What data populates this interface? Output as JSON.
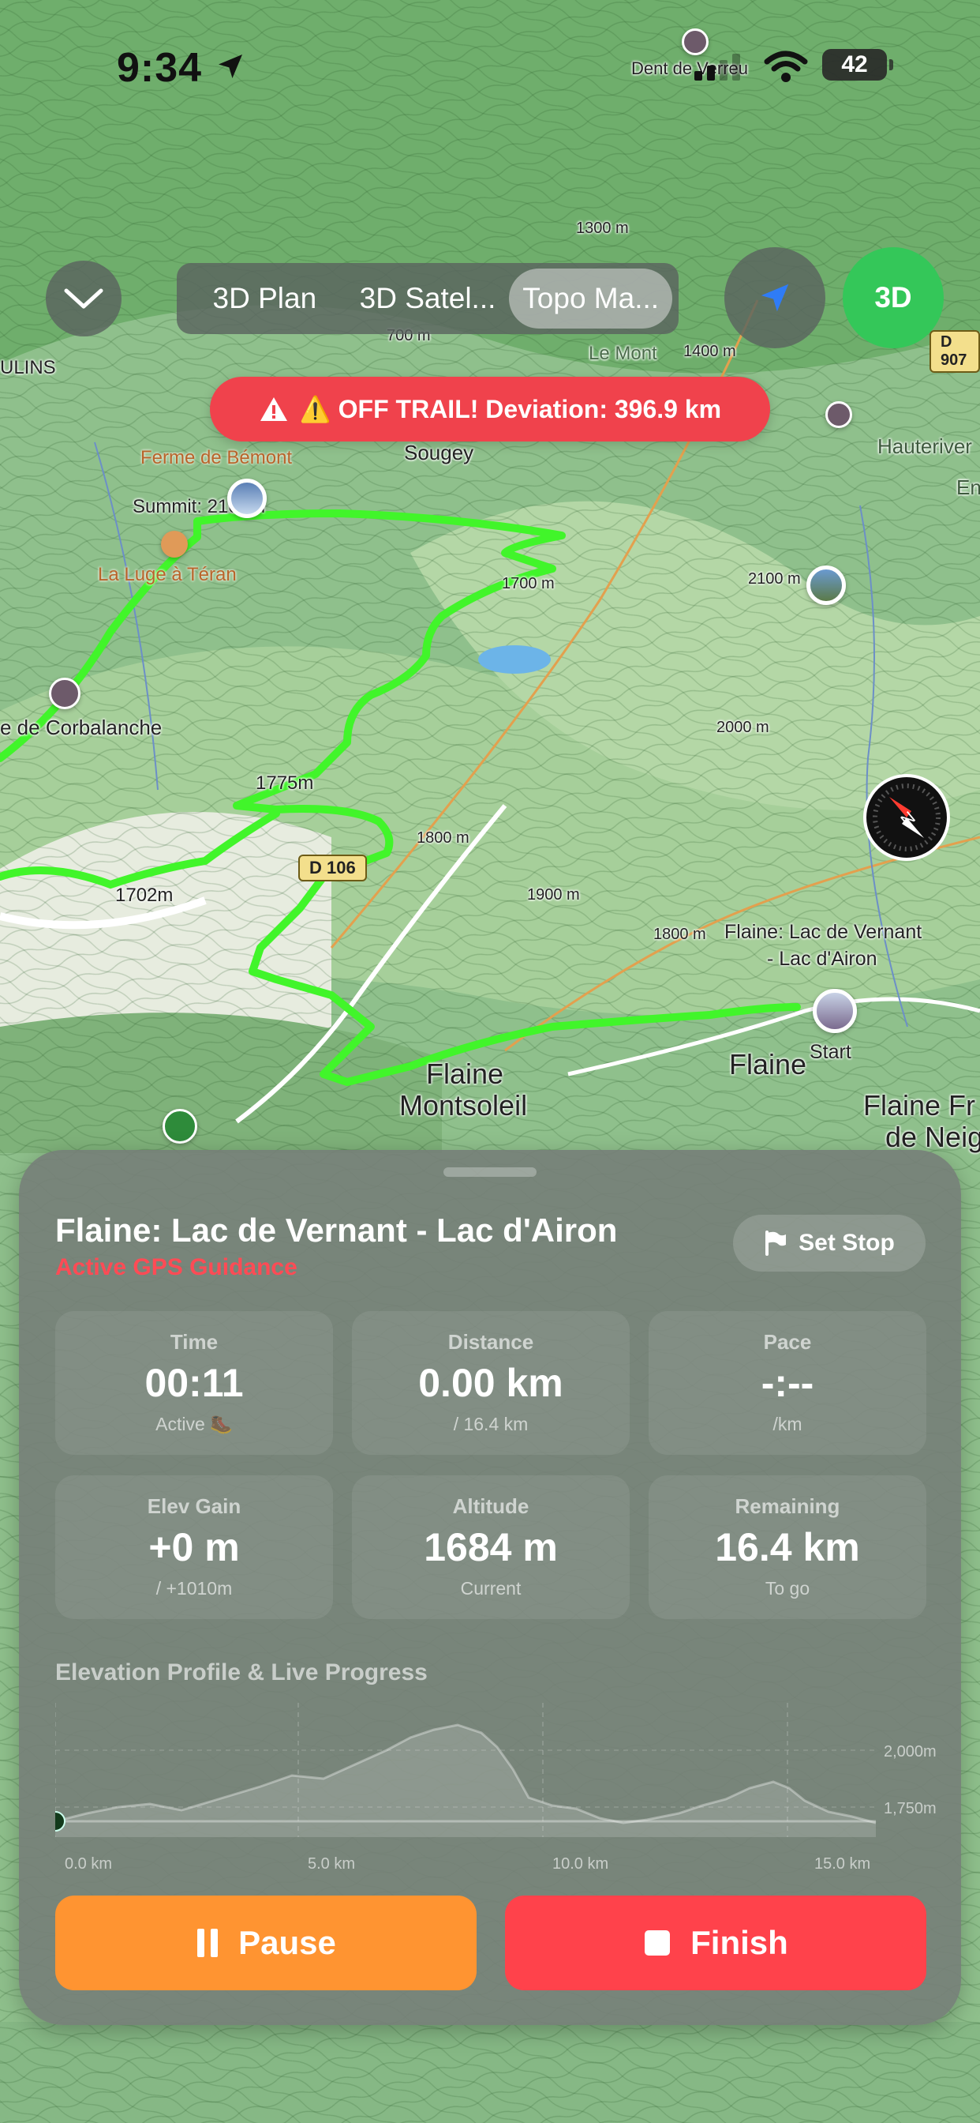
{
  "status_bar": {
    "time": "9:34",
    "battery": "42"
  },
  "map_controls": {
    "segments": [
      "3D Plan",
      "3D Satel...",
      "Topo Ma..."
    ],
    "active_segment": "Topo Ma...",
    "mode_button": "3D"
  },
  "alert": {
    "text": "⚠️ OFF TRAIL! Deviation: 396.9 km"
  },
  "map_labels": {
    "dent": "Dent de Verreu",
    "h1300": "1300 m",
    "h700": "700 m",
    "h1400": "1400 m",
    "ulins": "ULINS",
    "le_mont": "Le Mont",
    "d907": "D 907",
    "ferme": "Ferme de Bémont",
    "sougey": "Sougey",
    "hauterive": "Hauteriver",
    "en": "En",
    "summit": "Summit: 2100m",
    "lugea": "La Luge à Téran",
    "h1700": "1700 m",
    "h2100": "2100 m",
    "h2000": "2000 m",
    "corbalanche": "e de Corbalanche",
    "h1775": "1775m",
    "d106": "D 106",
    "h1800": "1800 m",
    "h1702": "1702m",
    "h1900": "1900 m",
    "h1800b": "1800 m",
    "trail_label_1": "Flaine: Lac de Vernant",
    "trail_label_2": "- Lac d'Airon",
    "start": "Start",
    "flaine": "Flaine",
    "montsoleil_1": "Flaine",
    "montsoleil_2": "Montsoleil",
    "flaine_fr_1": "Flaine Fr",
    "flaine_fr_2": "de Neig"
  },
  "panel": {
    "title": "Flaine: Lac de Vernant - Lac d'Airon",
    "subtitle": "Active GPS Guidance",
    "set_stop": "Set Stop",
    "stats": [
      {
        "label": "Time",
        "value": "00:11",
        "sub": "Active 🥾"
      },
      {
        "label": "Distance",
        "value": "0.00 km",
        "sub": "/ 16.4 km"
      },
      {
        "label": "Pace",
        "value": "-:--",
        "sub": "/km"
      },
      {
        "label": "Elev Gain",
        "value": "+0 m",
        "sub": "/ +1010m"
      },
      {
        "label": "Altitude",
        "value": "1684 m",
        "sub": "Current"
      },
      {
        "label": "Remaining",
        "value": "16.4 km",
        "sub": "To go"
      }
    ],
    "profile_title": "Elevation Profile & Live Progress",
    "profile_y_labels": [
      "2,000m",
      "1,750m"
    ],
    "profile_x_labels": [
      "0.0 km",
      "5.0 km",
      "10.0 km",
      "15.0 km"
    ],
    "progress_km": 0,
    "pause_label": "Pause",
    "finish_label": "Finish"
  },
  "colors": {
    "trail": "#41f52a",
    "alert": "#f0424c",
    "pause": "#ff9431",
    "finish": "#ff424b",
    "mode_3d": "#34c759",
    "guidance": "#ff4b55"
  }
}
